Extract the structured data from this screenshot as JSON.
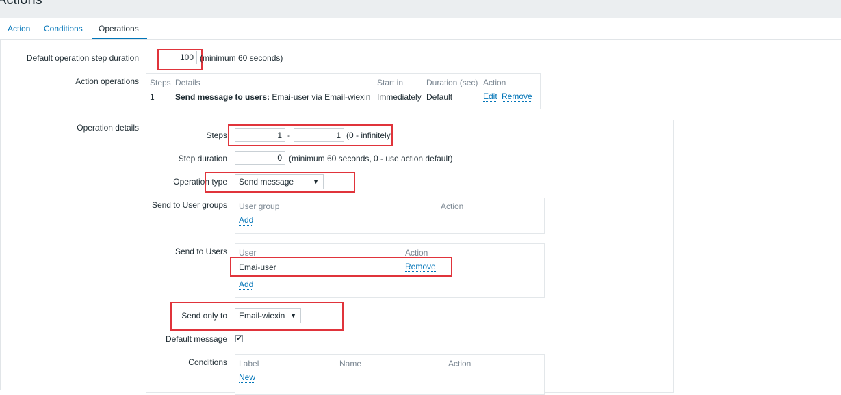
{
  "page": {
    "title": "Actions"
  },
  "tabs": [
    {
      "label": "Action"
    },
    {
      "label": "Conditions"
    },
    {
      "label": "Operations"
    }
  ],
  "default_step": {
    "label": "Default operation step duration",
    "value": "100",
    "hint": "(minimum 60 seconds)"
  },
  "action_operations": {
    "label": "Action operations",
    "headers": {
      "steps": "Steps",
      "details": "Details",
      "start_in": "Start in",
      "duration": "Duration (sec)",
      "action": "Action"
    },
    "rows": [
      {
        "steps": "1",
        "details_bold": "Send message to users:",
        "details_rest": " Emai-user via Email-wiexin",
        "start_in": "Immediately",
        "duration": "Default",
        "edit": "Edit",
        "remove": "Remove"
      }
    ]
  },
  "operation_details": {
    "label": "Operation details",
    "steps": {
      "label": "Steps",
      "from": "1",
      "separator": "-",
      "to": "1",
      "hint": "(0 - infinitely)"
    },
    "step_duration": {
      "label": "Step duration",
      "value": "0",
      "hint": "(minimum 60 seconds, 0 - use action default)"
    },
    "operation_type": {
      "label": "Operation type",
      "value": "Send message"
    },
    "user_groups": {
      "label": "Send to User groups",
      "col_group": "User group",
      "col_action": "Action",
      "add": "Add"
    },
    "users": {
      "label": "Send to Users",
      "col_user": "User",
      "col_action": "Action",
      "rows": [
        {
          "name": "Emai-user",
          "remove": "Remove"
        }
      ],
      "add": "Add"
    },
    "send_only_to": {
      "label": "Send only to",
      "value": "Email-wiexin"
    },
    "default_message": {
      "label": "Default message",
      "checked": "✔"
    },
    "conditions": {
      "label": "Conditions",
      "col_label": "Label",
      "col_name": "Name",
      "col_action": "Action",
      "new": "New"
    }
  },
  "colors": {
    "link": "#0275b8",
    "highlight": "#e0343b",
    "text": "#1f2c33",
    "muted": "#7b8792"
  }
}
